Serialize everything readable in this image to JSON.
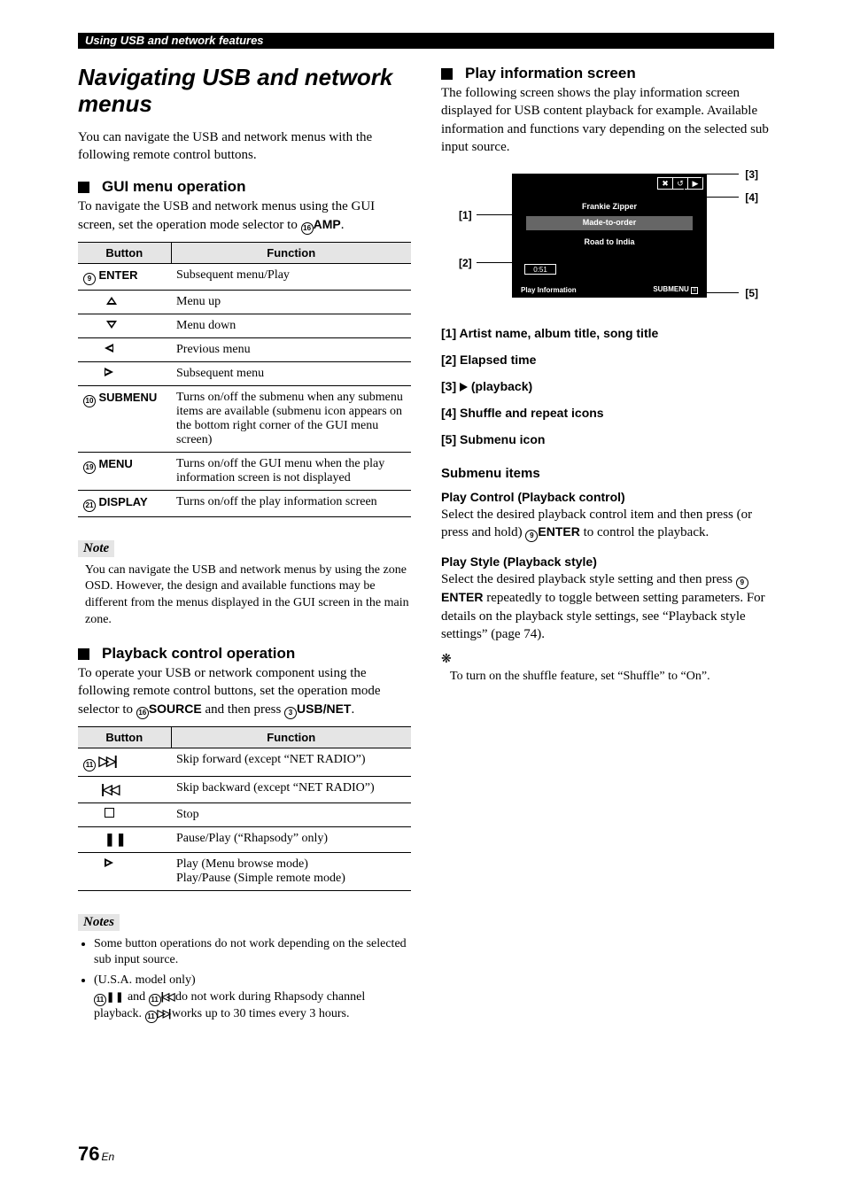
{
  "topbar": "Using USB and network features",
  "main_title": "Navigating USB and network menus",
  "intro": "You can navigate the USB and network menus with the following remote control buttons.",
  "gui": {
    "heading": "GUI menu operation",
    "intro_pre": "To navigate the USB and network menus using the GUI screen, set the operation mode selector to ",
    "selector_num": "16",
    "selector_label": "AMP",
    "intro_post": "."
  },
  "table1": {
    "head_button": "Button",
    "head_function": "Function",
    "rows": [
      {
        "num": "9",
        "name": "ENTER",
        "fn": "Subsequent menu/Play"
      },
      {
        "icon": "up",
        "fn": "Menu up"
      },
      {
        "icon": "down",
        "fn": "Menu down"
      },
      {
        "icon": "left",
        "fn": "Previous menu"
      },
      {
        "icon": "right",
        "fn": "Subsequent menu"
      },
      {
        "num": "10",
        "name": "SUBMENU",
        "fn": "Turns on/off the submenu when any submenu items are available (submenu icon appears on the bottom right corner of the GUI menu screen)"
      },
      {
        "num": "19",
        "name": "MENU",
        "fn": "Turns on/off the GUI menu when the play information screen is not displayed"
      },
      {
        "num": "21",
        "name": "DISPLAY",
        "fn": "Turns on/off the play information screen"
      }
    ]
  },
  "note1": {
    "label": "Note",
    "text": "You can navigate the USB and network menus by using the zone OSD. However, the design and available functions may be different from the menus displayed in the GUI screen in the main zone."
  },
  "playback": {
    "heading": "Playback control operation",
    "intro_pre": "To operate your USB or network component using the following remote control buttons, set the operation mode selector to ",
    "sel1_num": "16",
    "sel1_label": "SOURCE",
    "mid": " and then press ",
    "sel2_num": "3",
    "sel2_label": "USB/NET",
    "post": "."
  },
  "table2": {
    "head_button": "Button",
    "head_function": "Function",
    "rows": [
      {
        "num": "11",
        "icon": "skipfwd",
        "fn": "Skip forward (except “NET RADIO”)"
      },
      {
        "icon": "skipbwd",
        "fn": "Skip backward (except “NET RADIO”)"
      },
      {
        "icon": "stop",
        "fn": "Stop"
      },
      {
        "icon": "pause",
        "fn": "Pause/Play (“Rhapsody” only)"
      },
      {
        "icon": "play",
        "fn": "Play (Menu browse mode)\nPlay/Pause (Simple remote mode)"
      }
    ]
  },
  "notes2": {
    "label": "Notes",
    "items": [
      "Some button operations do not work depending on the selected sub input source.",
      "(U.S.A. model only)"
    ],
    "usa_line1_pre_num": "11",
    "usa_line1_mid": " and ",
    "usa_line1_num2": "11",
    "usa_line1_post": " do not work during Rhapsody channel playback. ",
    "usa_line2_num": "11",
    "usa_line2_post": " works up to 30 times every 3 hours."
  },
  "right": {
    "heading": "Play information screen",
    "intro": "The following screen shows the play information screen displayed for USB content playback for example. Available information and functions vary depending on the selected sub input source."
  },
  "screen": {
    "row1": "Frankie Zipper",
    "row2": "Made-to-order",
    "row3": "Road to India",
    "time": "0:51",
    "footer": "Play Information",
    "submenu": "SUBMENU",
    "icon1": "✖",
    "icon2": "↺",
    "icon3": "▶"
  },
  "labels": {
    "l1": "[1]",
    "l2": "[2]",
    "l3": "[3]",
    "l4": "[4]",
    "l5": "[5]"
  },
  "callouts": {
    "c1": "[1] Artist name, album title, song title",
    "c2": "[2] Elapsed time",
    "c3_pre": "[3] ",
    "c3_post": " (playback)",
    "c4": "[4] Shuffle and repeat icons",
    "c5": "[5] Submenu icon"
  },
  "subitems": {
    "heading": "Submenu items",
    "pc_head": "Play Control (Playback control)",
    "pc_text_pre": "Select the desired playback control item and then press (or press and hold) ",
    "pc_num": "9",
    "pc_label": "ENTER",
    "pc_text_post": " to control the playback.",
    "ps_head": "Play Style (Playback style)",
    "ps_text_pre": "Select the desired playback style setting and then press ",
    "ps_num": "9",
    "ps_label": "ENTER",
    "ps_text_post": " repeatedly to toggle between setting parameters. For details on the playback style settings, see “Playback style settings” (page 74)."
  },
  "tip": "To turn on the shuffle feature, set “Shuffle” to “On”.",
  "pagenum": "76",
  "pagelang": "En"
}
